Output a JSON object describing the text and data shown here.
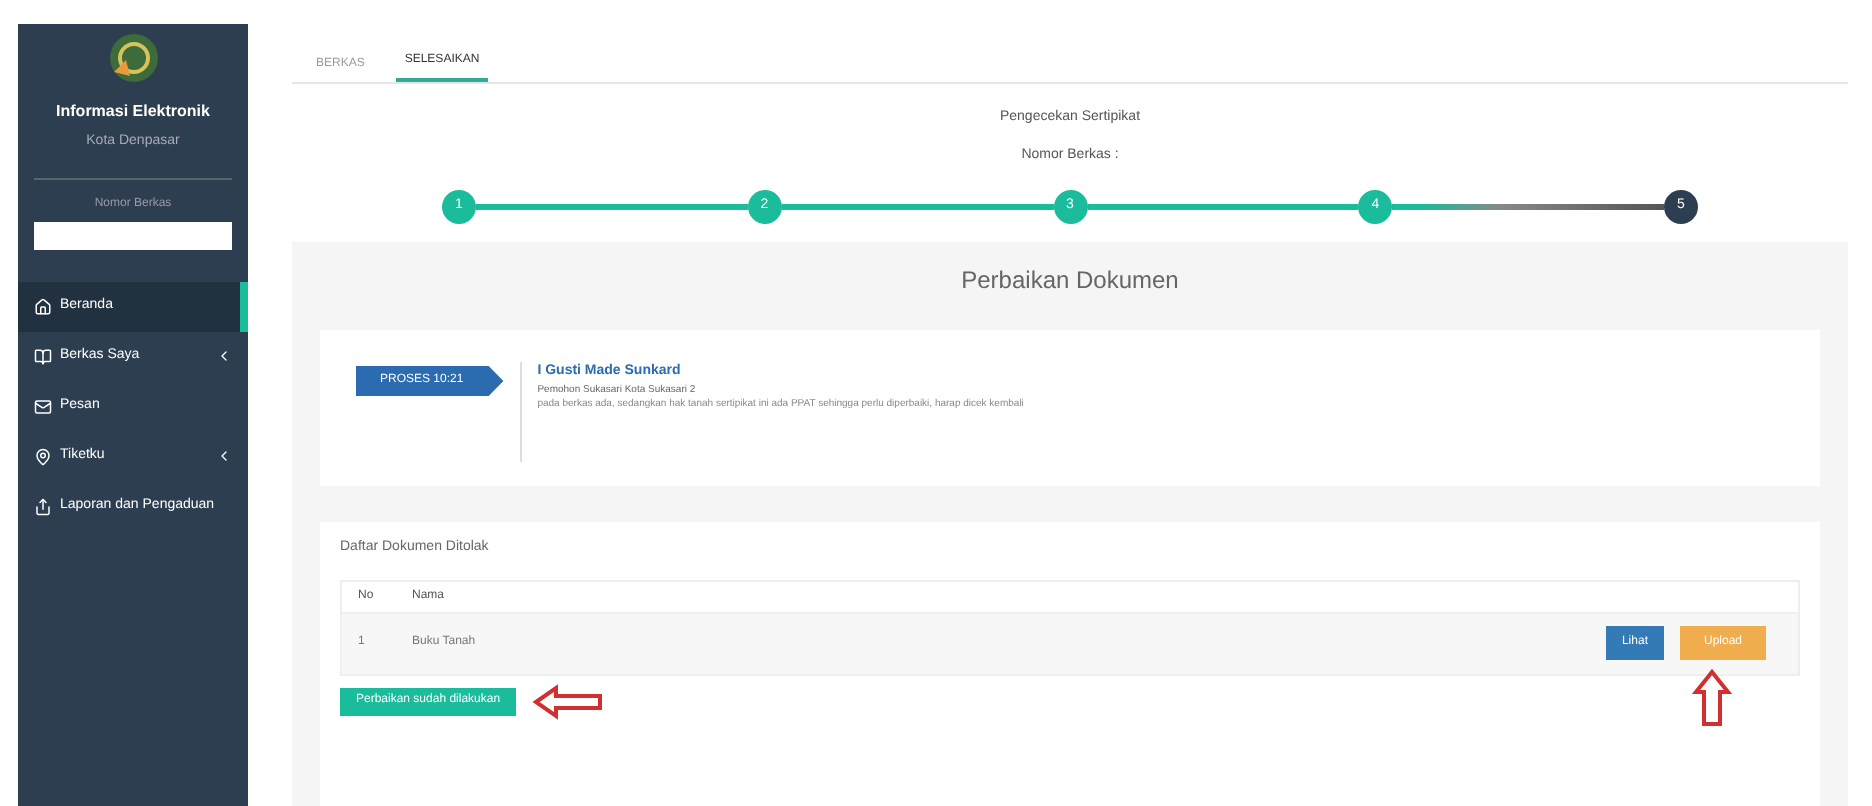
{
  "sidebar": {
    "title": "Informasi Elektronik",
    "subtitle": "Kota Denpasar",
    "search_label": "Nomor Berkas",
    "items": [
      {
        "label": "Beranda",
        "selected": true,
        "expandable": false,
        "kind": "home"
      },
      {
        "label": "Berkas Saya",
        "selected": false,
        "expandable": true,
        "kind": "book"
      },
      {
        "label": "Pesan",
        "selected": false,
        "expandable": false,
        "kind": "mail"
      },
      {
        "label": "Tiketku",
        "selected": false,
        "expandable": true,
        "kind": "pin"
      },
      {
        "label": "Laporan dan Pengaduan",
        "selected": false,
        "expandable": false,
        "kind": "share"
      }
    ]
  },
  "tabs": [
    {
      "label": "BERKAS",
      "selected": false
    },
    {
      "label": "SELESAIKAN",
      "selected": true
    }
  ],
  "progress": {
    "title": "Pengecekan Sertipikat",
    "subtitle": "Nomor Berkas :",
    "steps": [
      {
        "label": "1",
        "done": true
      },
      {
        "label": "2",
        "done": true
      },
      {
        "label": "3",
        "done": true
      },
      {
        "label": "4",
        "done": true
      },
      {
        "label": "5",
        "done": false
      }
    ]
  },
  "section_title": "Perbaikan Dokumen",
  "timeline": {
    "badge": "PROSES 10:21",
    "name": "I Gusti Made Sunkard",
    "role": "Pemohon Sukasari Kota Sukasari 2",
    "note": "pada berkas ada, sedangkan hak tanah sertipikat ini ada PPAT sehingga perlu diperbaiki, harap dicek kembali"
  },
  "documents": {
    "title": "Daftar Dokumen Ditolak",
    "columns": [
      "No",
      "Nama"
    ],
    "rows": [
      {
        "no": "1",
        "name": "Buku Tanah",
        "actions": [
          "Lihat",
          "Upload"
        ]
      }
    ],
    "submit": "Perbaikan sudah dilakukan"
  }
}
